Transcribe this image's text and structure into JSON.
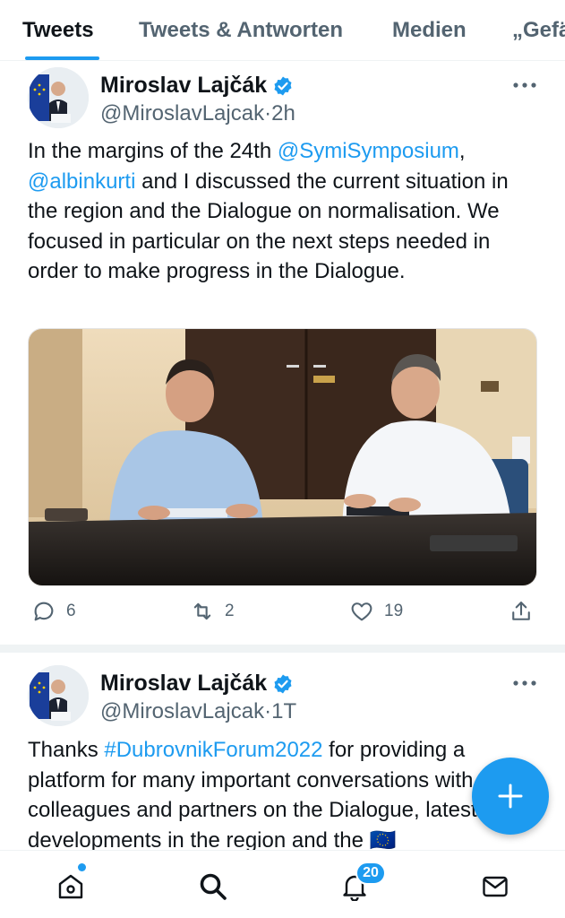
{
  "tabs": [
    {
      "label": "Tweets",
      "active": true
    },
    {
      "label": "Tweets & Antworten",
      "active": false
    },
    {
      "label": "Medien",
      "active": false
    },
    {
      "label": "„Gefä",
      "active": false
    }
  ],
  "tweets": [
    {
      "author": "Miroslav Lajčák",
      "handle": "@MiroslavLajcak",
      "separator": "·",
      "time": "2h",
      "text": [
        {
          "t": "In the margins of the 24th ",
          "link": false
        },
        {
          "t": "@SymiSymposium",
          "link": true
        },
        {
          "t": ", ",
          "link": false
        },
        {
          "t": "@albinkurti",
          "link": true
        },
        {
          "t": " and I discussed the current situation in the region and the Dialogue on normalisation. We focused in particular on the next steps needed in order to make progress in the Dialogue.",
          "link": false
        }
      ],
      "replies": "6",
      "retweets": "2",
      "likes": "19"
    },
    {
      "author": "Miroslav Lajčák",
      "handle": "@MiroslavLajcak",
      "separator": "·",
      "time": "1T",
      "text": [
        {
          "t": "Thanks ",
          "link": false
        },
        {
          "t": "#DubrovnikForum2022",
          "link": true
        },
        {
          "t": " for providing a platform for many important conversations with my colleagues and partners on the Dialogue, latest developments in the region and the ",
          "link": false
        },
        {
          "t": "🇪🇺",
          "link": false
        }
      ]
    }
  ],
  "notifications_badge": "20",
  "colors": {
    "accent": "#1d9bf0",
    "text": "#0f1419",
    "secondary": "#536471"
  },
  "icons": [
    "verified-badge-icon",
    "more-icon",
    "reply-icon",
    "retweet-icon",
    "like-icon",
    "share-icon",
    "compose-plus-icon",
    "home-icon",
    "search-icon",
    "bell-icon",
    "mail-icon"
  ]
}
